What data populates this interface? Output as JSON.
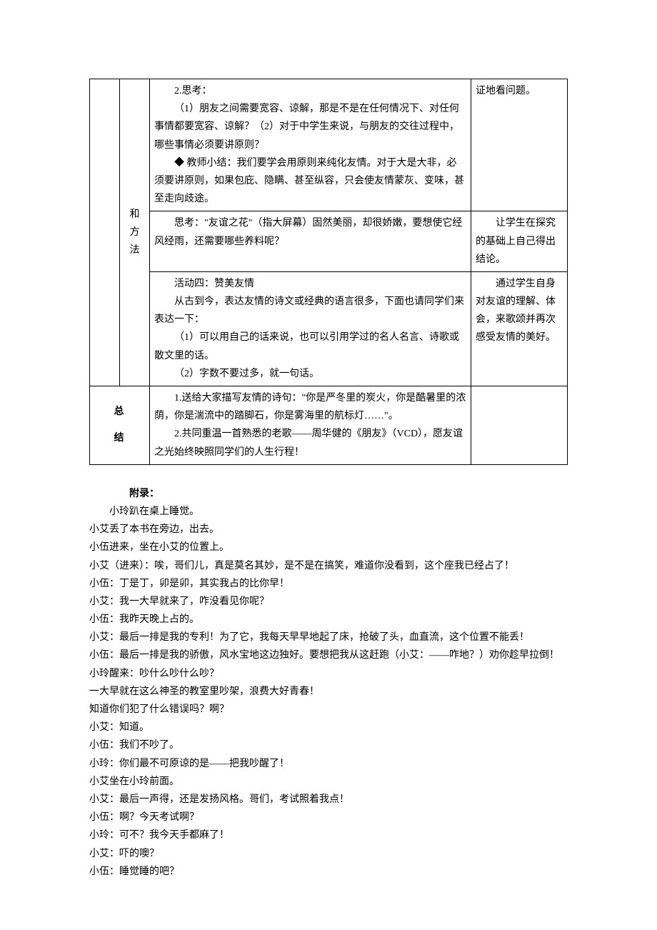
{
  "table": {
    "col2_labels": [
      "和",
      "方",
      "法"
    ],
    "row1": {
      "content": [
        "2.思考：",
        "（1）朋友之间需要宽容、谅解，那是不是在任何情况下、对任何事情都要宽容、谅解？（2）对于中学生来说，与朋友的交往过程中，哪些事情必须要讲原则？",
        "◆ 教师小结：我们要学会用原则来纯化友情。对于大是大非，必须要讲原则，如果包庇、隐瞒、甚至纵容，只会使友情蒙灰、变味，甚至走向歧途。"
      ],
      "note": "证地看问题。"
    },
    "row2": {
      "content": "思考：\"友谊之花\"（指大屏幕）固然美丽，却很娇嫩，要想使它经风经雨，还需要哪些养料呢？",
      "note": "让学生在探究的基础上自己得出结论。"
    },
    "row3": {
      "content": [
        "活动四：赞美友情",
        "从古到今，表达友情的诗文或经典的语言很多，下面也请同学们来表达一下：",
        "（1）可以用自己的话来说，也可以引用学过的名人名言、诗歌或散文里的话。",
        "（2）字数不要过多，就一句话。"
      ],
      "note": "通过学生自身对友谊的理解、体会，来歌颂并再次感受友情的美好。"
    },
    "summary_label_1": "总",
    "summary_label_2": "结",
    "summary": [
      "1.送给大家描写友情的诗句：\"你是严冬里的炭火，你是酷暑里的浓荫，你是湍流中的踏脚石，你是雾海里的航标灯……\"。",
      "2.共同重温一首熟悉的老歌——周华健的《朋友》（VCD），愿友谊之光始终映照同学们的人生行程！"
    ]
  },
  "appendix": {
    "heading": "附录：",
    "lines": [
      {
        "cls": "fi",
        "text": "小玲趴在桌上睡觉。"
      },
      {
        "cls": "plain",
        "text": "小艾丢了本书在旁边，出去。"
      },
      {
        "cls": "plain",
        "text": "小伍进来，坐在小艾的位置上。"
      },
      {
        "cls": "plain",
        "text": "小艾（进来）：唉，哥们儿，真是莫名其妙，是不是在搞笑，难道你没看到，这个座我已经占了！"
      },
      {
        "cls": "plain",
        "text": "小伍：丁是丁，卯是卯，其实我占的比你早！"
      },
      {
        "cls": "plain",
        "text": "小艾：我一大早就来了，咋没看见你呢？"
      },
      {
        "cls": "plain",
        "text": "小伍：我昨天晚上占的。"
      },
      {
        "cls": "plain",
        "text": "小艾：最后一排是我的专利！为了它，我每天早早地起了床，抢破了头，血直流，这个位置不能丢！"
      },
      {
        "cls": "plain",
        "text": "小伍：最后一排是我的骄傲，风水宝地这边独好。要想把我从这赶跑（小艾：——咋地？）劝你趁早拉倒！"
      },
      {
        "cls": "plain",
        "text": "小玲醒来：吵什么吵什么吵？"
      },
      {
        "cls": "plain",
        "text": "一大早就在这么神圣的教室里吵架，浪费大好青春！"
      },
      {
        "cls": "plain",
        "text": "知道你们犯了什么错误吗？啊？"
      },
      {
        "cls": "plain",
        "text": "小艾：知道。"
      },
      {
        "cls": "plain",
        "text": "小伍：我们不吵了。"
      },
      {
        "cls": "plain",
        "text": "小玲：你们最不可原谅的是——把我吵醒了！"
      },
      {
        "cls": "plain",
        "text": "小艾坐在小玲前面。"
      },
      {
        "cls": "plain",
        "text": "小艾：最后一声得，还是发扬风格。哥们，考试照着我点！"
      },
      {
        "cls": "plain",
        "text": "小伍：啊？今天考试啊？"
      },
      {
        "cls": "plain",
        "text": "小玲：可不？我今天手都麻了！"
      },
      {
        "cls": "plain",
        "text": "小艾：吓的噢？"
      },
      {
        "cls": "plain",
        "text": "小伍：睡觉睡的吧？"
      }
    ]
  }
}
